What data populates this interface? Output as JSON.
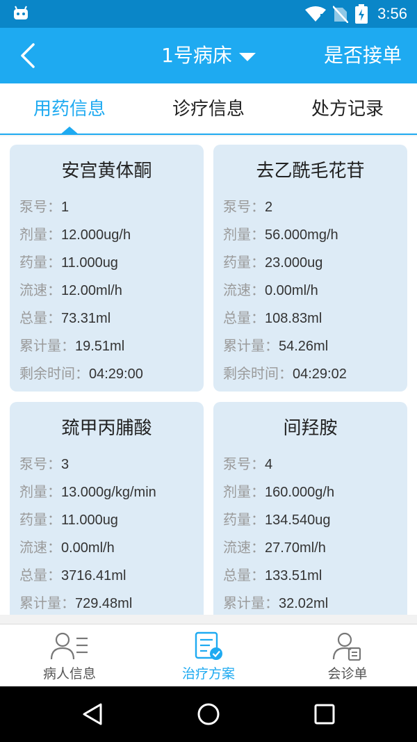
{
  "status_bar": {
    "time": "3:56"
  },
  "header": {
    "title": "1号病床",
    "accept_label": "是否接单"
  },
  "tabs": [
    "用药信息",
    "诊疗信息",
    "处方记录"
  ],
  "active_tab": 0,
  "drugs": [
    {
      "name": "安宫黄体酮",
      "rows": [
        {
          "k": "泵号：",
          "v": "1"
        },
        {
          "k": "剂量：",
          "v": "12.000ug/h"
        },
        {
          "k": "药量：",
          "v": "11.000ug"
        },
        {
          "k": "流速：",
          "v": "12.00ml/h"
        },
        {
          "k": "总量：",
          "v": "73.31ml"
        },
        {
          "k": "累计量：",
          "v": "19.51ml"
        },
        {
          "k": "剩余时间：",
          "v": "04:29:00"
        }
      ]
    },
    {
      "name": "去乙酰毛花苷",
      "rows": [
        {
          "k": "泵号：",
          "v": "2"
        },
        {
          "k": "剂量：",
          "v": "56.000mg/h"
        },
        {
          "k": "药量：",
          "v": "23.000ug"
        },
        {
          "k": "流速：",
          "v": "0.00ml/h"
        },
        {
          "k": "总量：",
          "v": "108.83ml"
        },
        {
          "k": "累计量：",
          "v": "54.26ml"
        },
        {
          "k": "剩余时间：",
          "v": "04:29:02"
        }
      ]
    },
    {
      "name": "巯甲丙脯酸",
      "rows": [
        {
          "k": "泵号：",
          "v": "3"
        },
        {
          "k": "剂量：",
          "v": "13.000g/kg/min"
        },
        {
          "k": "药量：",
          "v": "11.000ug"
        },
        {
          "k": "流速：",
          "v": "0.00ml/h"
        },
        {
          "k": "总量：",
          "v": "3716.41ml"
        },
        {
          "k": "累计量：",
          "v": "729.48ml"
        }
      ]
    },
    {
      "name": "间羟胺",
      "rows": [
        {
          "k": "泵号：",
          "v": "4"
        },
        {
          "k": "剂量：",
          "v": "160.000g/h"
        },
        {
          "k": "药量：",
          "v": "134.540ug"
        },
        {
          "k": "流速：",
          "v": "27.70ml/h"
        },
        {
          "k": "总量：",
          "v": "133.51ml"
        },
        {
          "k": "累计量：",
          "v": "32.02ml"
        }
      ]
    }
  ],
  "bottom_nav": [
    {
      "label": "病人信息",
      "icon": "patient-info-icon"
    },
    {
      "label": "治疗方案",
      "icon": "treatment-plan-icon"
    },
    {
      "label": "会诊单",
      "icon": "consultation-icon"
    }
  ],
  "active_nav": 1,
  "colors": {
    "primary": "#1eaaf1",
    "status_bar": "#0a86c8",
    "card_bg": "#ddebf6",
    "label_gray": "#9a9a9a"
  }
}
